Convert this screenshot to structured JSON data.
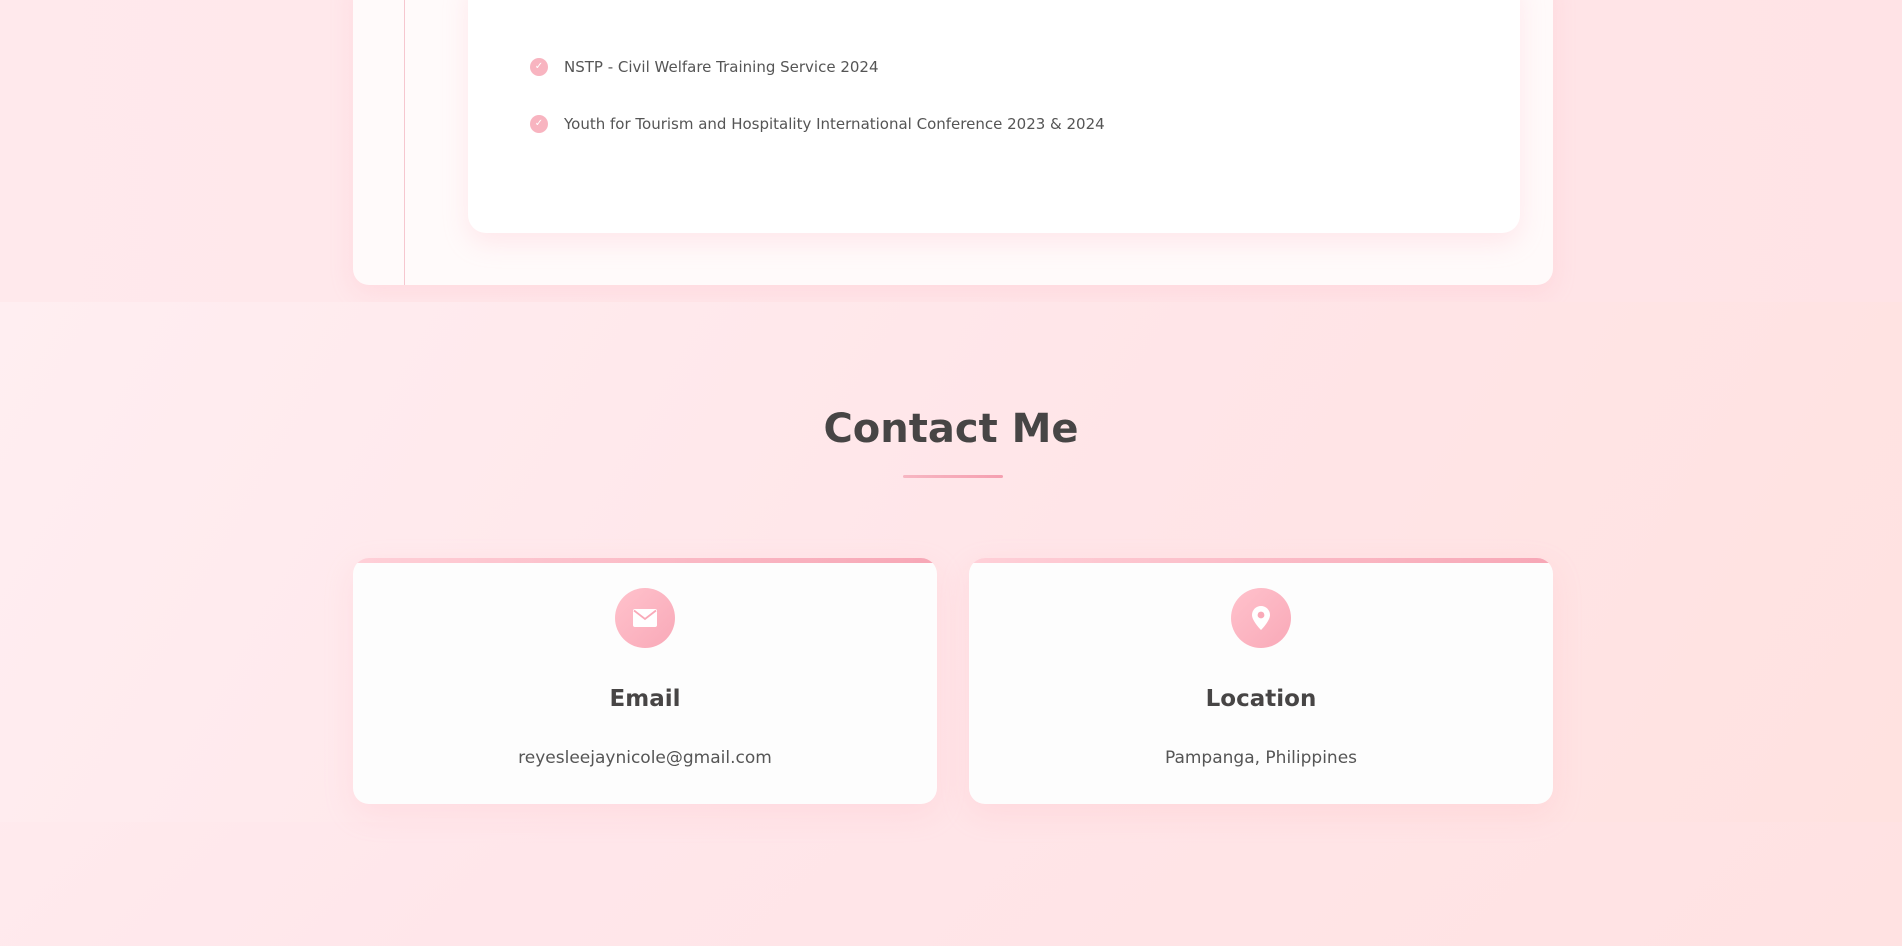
{
  "awards": {
    "items": [
      {
        "label": "NSTP - Civil Welfare Training Service 2024",
        "icon": "check-circle-icon"
      },
      {
        "label": "Youth for Tourism and Hospitality International Conference 2023 & 2024",
        "icon": "check-circle-icon"
      }
    ]
  },
  "contact": {
    "title": "Contact Me",
    "cards": [
      {
        "icon": "envelope-icon",
        "label": "Email",
        "value": "reyesleejaynicole@gmail.com"
      },
      {
        "icon": "map-pin-icon",
        "label": "Location",
        "value": "Pampanga, Philippines"
      }
    ]
  },
  "colors": {
    "accent": "#f8b4c0",
    "heading": "#474545",
    "text": "#555555",
    "background": "#ffe9ec"
  }
}
